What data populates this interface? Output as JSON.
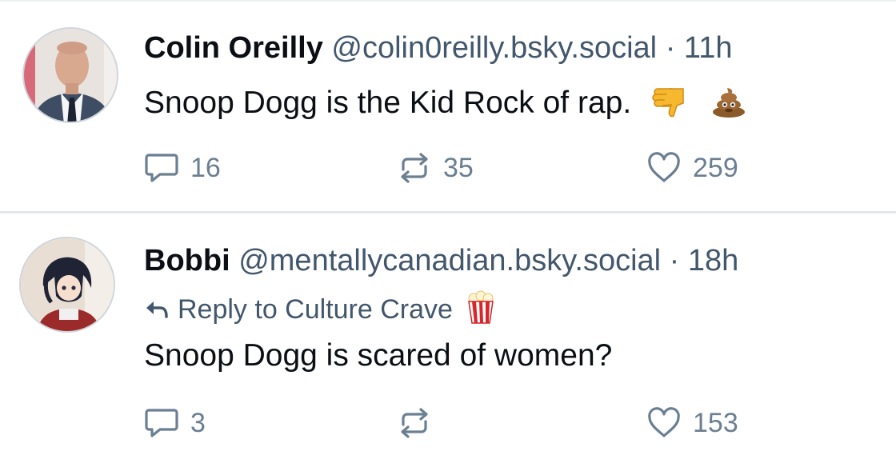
{
  "posts": [
    {
      "author_name": "Colin Oreilly",
      "handle": "@colin0reilly.bsky.social",
      "time": "11h",
      "text": "Snoop Dogg is the Kid Rock of rap.",
      "emojis": [
        "thumbs-down",
        "pile-of-poo"
      ],
      "replies": "16",
      "reposts": "35",
      "likes": "259"
    },
    {
      "author_name": "Bobbi",
      "handle": "@mentallycanadian.bsky.social",
      "time": "18h",
      "reply_to": "Reply to Culture Crave",
      "reply_to_emoji": "popcorn",
      "text": "Snoop Dogg is scared of women?",
      "replies": "3",
      "reposts": "",
      "likes": "153"
    }
  ],
  "separator": "·",
  "colors": {
    "text": "#0b0f14",
    "secondary": "#42576c",
    "icon": "#6b7f92",
    "divider": "#e3e7eb"
  }
}
